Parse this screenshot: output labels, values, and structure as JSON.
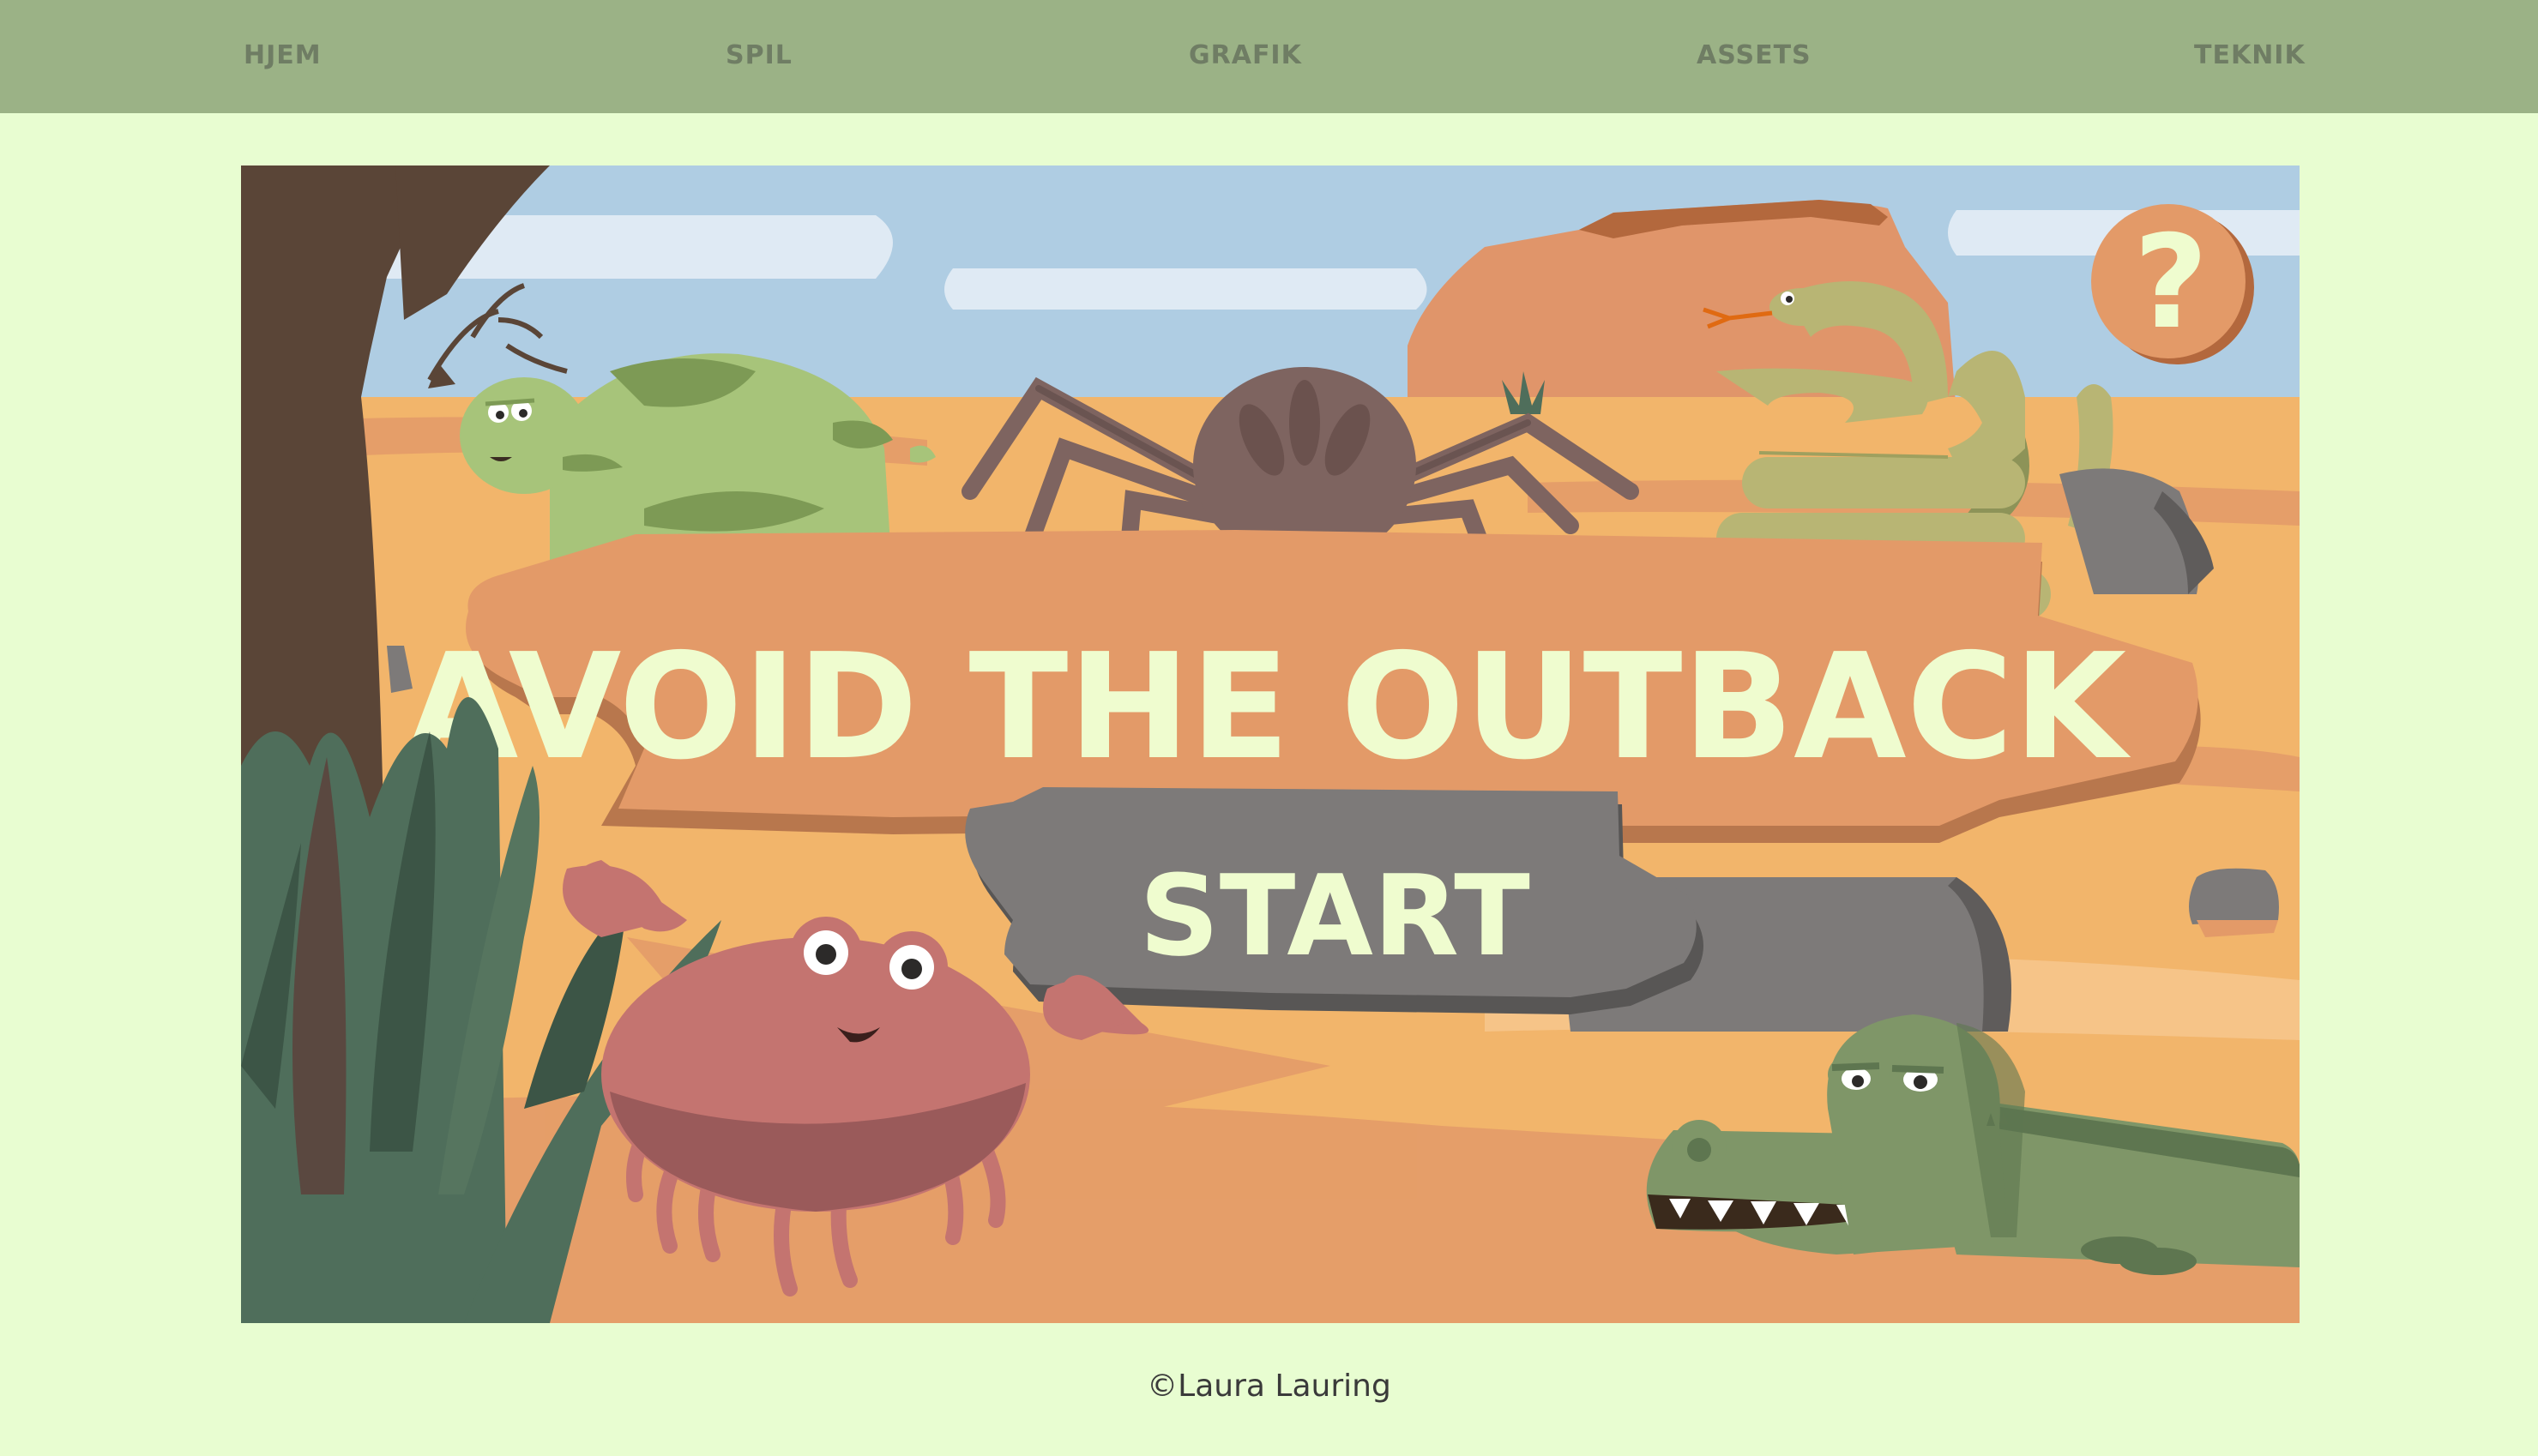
{
  "nav": {
    "items": [
      {
        "label": "HJEM"
      },
      {
        "label": "SPIL"
      },
      {
        "label": "GRAFIK"
      },
      {
        "label": "ASSETS"
      },
      {
        "label": "TEKNIK"
      }
    ]
  },
  "game": {
    "title": "AVOID THE OUTBACK",
    "start_label": "START",
    "help_label": "?"
  },
  "footer": {
    "copyright": "©Laura Lauring"
  },
  "colors": {
    "nav_bg": "#9bb286",
    "page_bg": "#e8fdd1",
    "nav_text": "#6f7d64",
    "sign_wood": "#e39a68",
    "title_text": "#effccf",
    "start_sign": "#7d7a79",
    "sky": "#afcde3",
    "sand": "#f2b56b"
  }
}
